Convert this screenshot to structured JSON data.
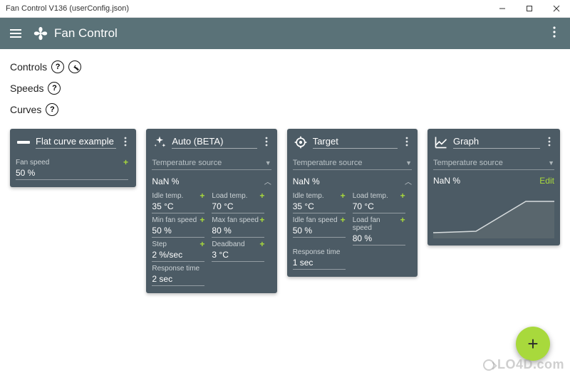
{
  "window": {
    "title": "Fan Control V136 (userConfig.json)"
  },
  "appbar": {
    "title": "Fan Control"
  },
  "sections": {
    "controls": "Controls",
    "speeds": "Speeds",
    "curves": "Curves"
  },
  "cards": {
    "flat": {
      "title": "Flat curve example",
      "fan_speed_label": "Fan speed",
      "fan_speed_value": "50 %"
    },
    "auto": {
      "title": "Auto (BETA)",
      "temp_source": "Temperature source",
      "percent": "NaN %",
      "fields": {
        "idle_temp": {
          "label": "Idle temp.",
          "value": "35 °C"
        },
        "load_temp": {
          "label": "Load temp.",
          "value": "70 °C"
        },
        "min_fan": {
          "label": "Min fan speed",
          "value": "50 %"
        },
        "max_fan": {
          "label": "Max fan speed",
          "value": "80 %"
        },
        "step": {
          "label": "Step",
          "value": "2 %/sec"
        },
        "deadband": {
          "label": "Deadband",
          "value": "3 °C"
        },
        "response": {
          "label": "Response time",
          "value": "2 sec"
        }
      }
    },
    "target": {
      "title": "Target",
      "temp_source": "Temperature source",
      "percent": "NaN %",
      "fields": {
        "idle_temp": {
          "label": "Idle temp.",
          "value": "35 °C"
        },
        "load_temp": {
          "label": "Load temp.",
          "value": "70 °C"
        },
        "idle_fan": {
          "label": "Idle fan speed",
          "value": "50 %"
        },
        "load_fan": {
          "label": "Load fan speed",
          "value": "80 %"
        },
        "response": {
          "label": "Response time",
          "value": "1 sec"
        }
      }
    },
    "graph": {
      "title": "Graph",
      "temp_source": "Temperature source",
      "percent": "NaN %",
      "edit": "Edit"
    }
  },
  "watermark": "LO4D.com"
}
